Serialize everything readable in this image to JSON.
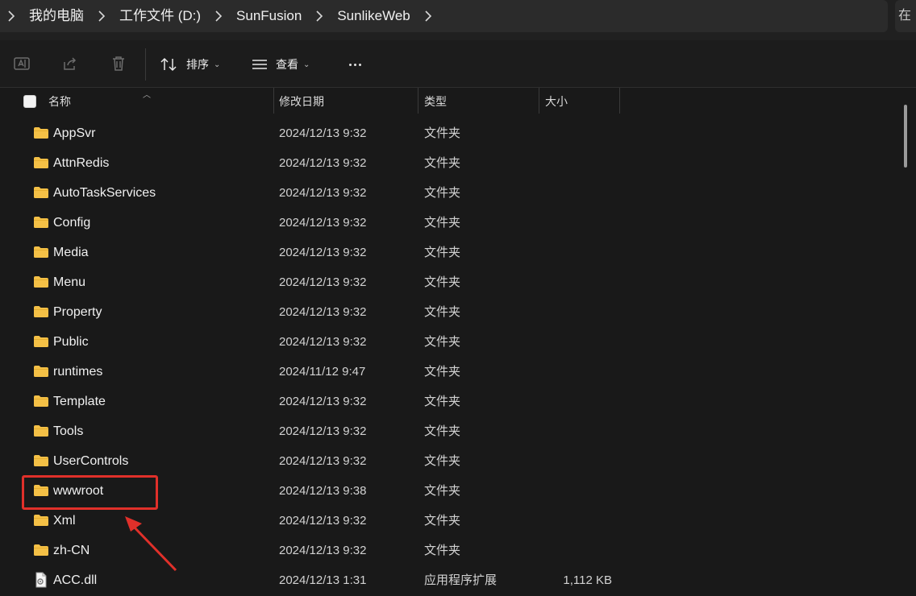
{
  "breadcrumb": {
    "items": [
      "我的电脑",
      "工作文件 (D:)",
      "SunFusion",
      "SunlikeWeb"
    ],
    "search_prefix": "在"
  },
  "toolbar": {
    "sort_label": "排序",
    "view_label": "查看"
  },
  "columns": {
    "name": "名称",
    "date": "修改日期",
    "type": "类型",
    "size": "大小"
  },
  "files": [
    {
      "name": "AppSvr",
      "date": "2024/12/13 9:32",
      "type": "文件夹",
      "size": "",
      "kind": "folder"
    },
    {
      "name": "AttnRedis",
      "date": "2024/12/13 9:32",
      "type": "文件夹",
      "size": "",
      "kind": "folder"
    },
    {
      "name": "AutoTaskServices",
      "date": "2024/12/13 9:32",
      "type": "文件夹",
      "size": "",
      "kind": "folder"
    },
    {
      "name": "Config",
      "date": "2024/12/13 9:32",
      "type": "文件夹",
      "size": "",
      "kind": "folder"
    },
    {
      "name": "Media",
      "date": "2024/12/13 9:32",
      "type": "文件夹",
      "size": "",
      "kind": "folder"
    },
    {
      "name": "Menu",
      "date": "2024/12/13 9:32",
      "type": "文件夹",
      "size": "",
      "kind": "folder"
    },
    {
      "name": "Property",
      "date": "2024/12/13 9:32",
      "type": "文件夹",
      "size": "",
      "kind": "folder"
    },
    {
      "name": "Public",
      "date": "2024/12/13 9:32",
      "type": "文件夹",
      "size": "",
      "kind": "folder"
    },
    {
      "name": "runtimes",
      "date": "2024/11/12 9:47",
      "type": "文件夹",
      "size": "",
      "kind": "folder"
    },
    {
      "name": "Template",
      "date": "2024/12/13 9:32",
      "type": "文件夹",
      "size": "",
      "kind": "folder"
    },
    {
      "name": "Tools",
      "date": "2024/12/13 9:32",
      "type": "文件夹",
      "size": "",
      "kind": "folder"
    },
    {
      "name": "UserControls",
      "date": "2024/12/13 9:32",
      "type": "文件夹",
      "size": "",
      "kind": "folder"
    },
    {
      "name": "wwwroot",
      "date": "2024/12/13 9:38",
      "type": "文件夹",
      "size": "",
      "kind": "folder"
    },
    {
      "name": "Xml",
      "date": "2024/12/13 9:32",
      "type": "文件夹",
      "size": "",
      "kind": "folder"
    },
    {
      "name": "zh-CN",
      "date": "2024/12/13 9:32",
      "type": "文件夹",
      "size": "",
      "kind": "folder"
    },
    {
      "name": "ACC.dll",
      "date": "2024/12/13 1:31",
      "type": "应用程序扩展",
      "size": "1,112 KB",
      "kind": "dll"
    }
  ],
  "colors": {
    "background": "#191919",
    "folder": "#f4c046",
    "annotation": "#e0302a"
  }
}
